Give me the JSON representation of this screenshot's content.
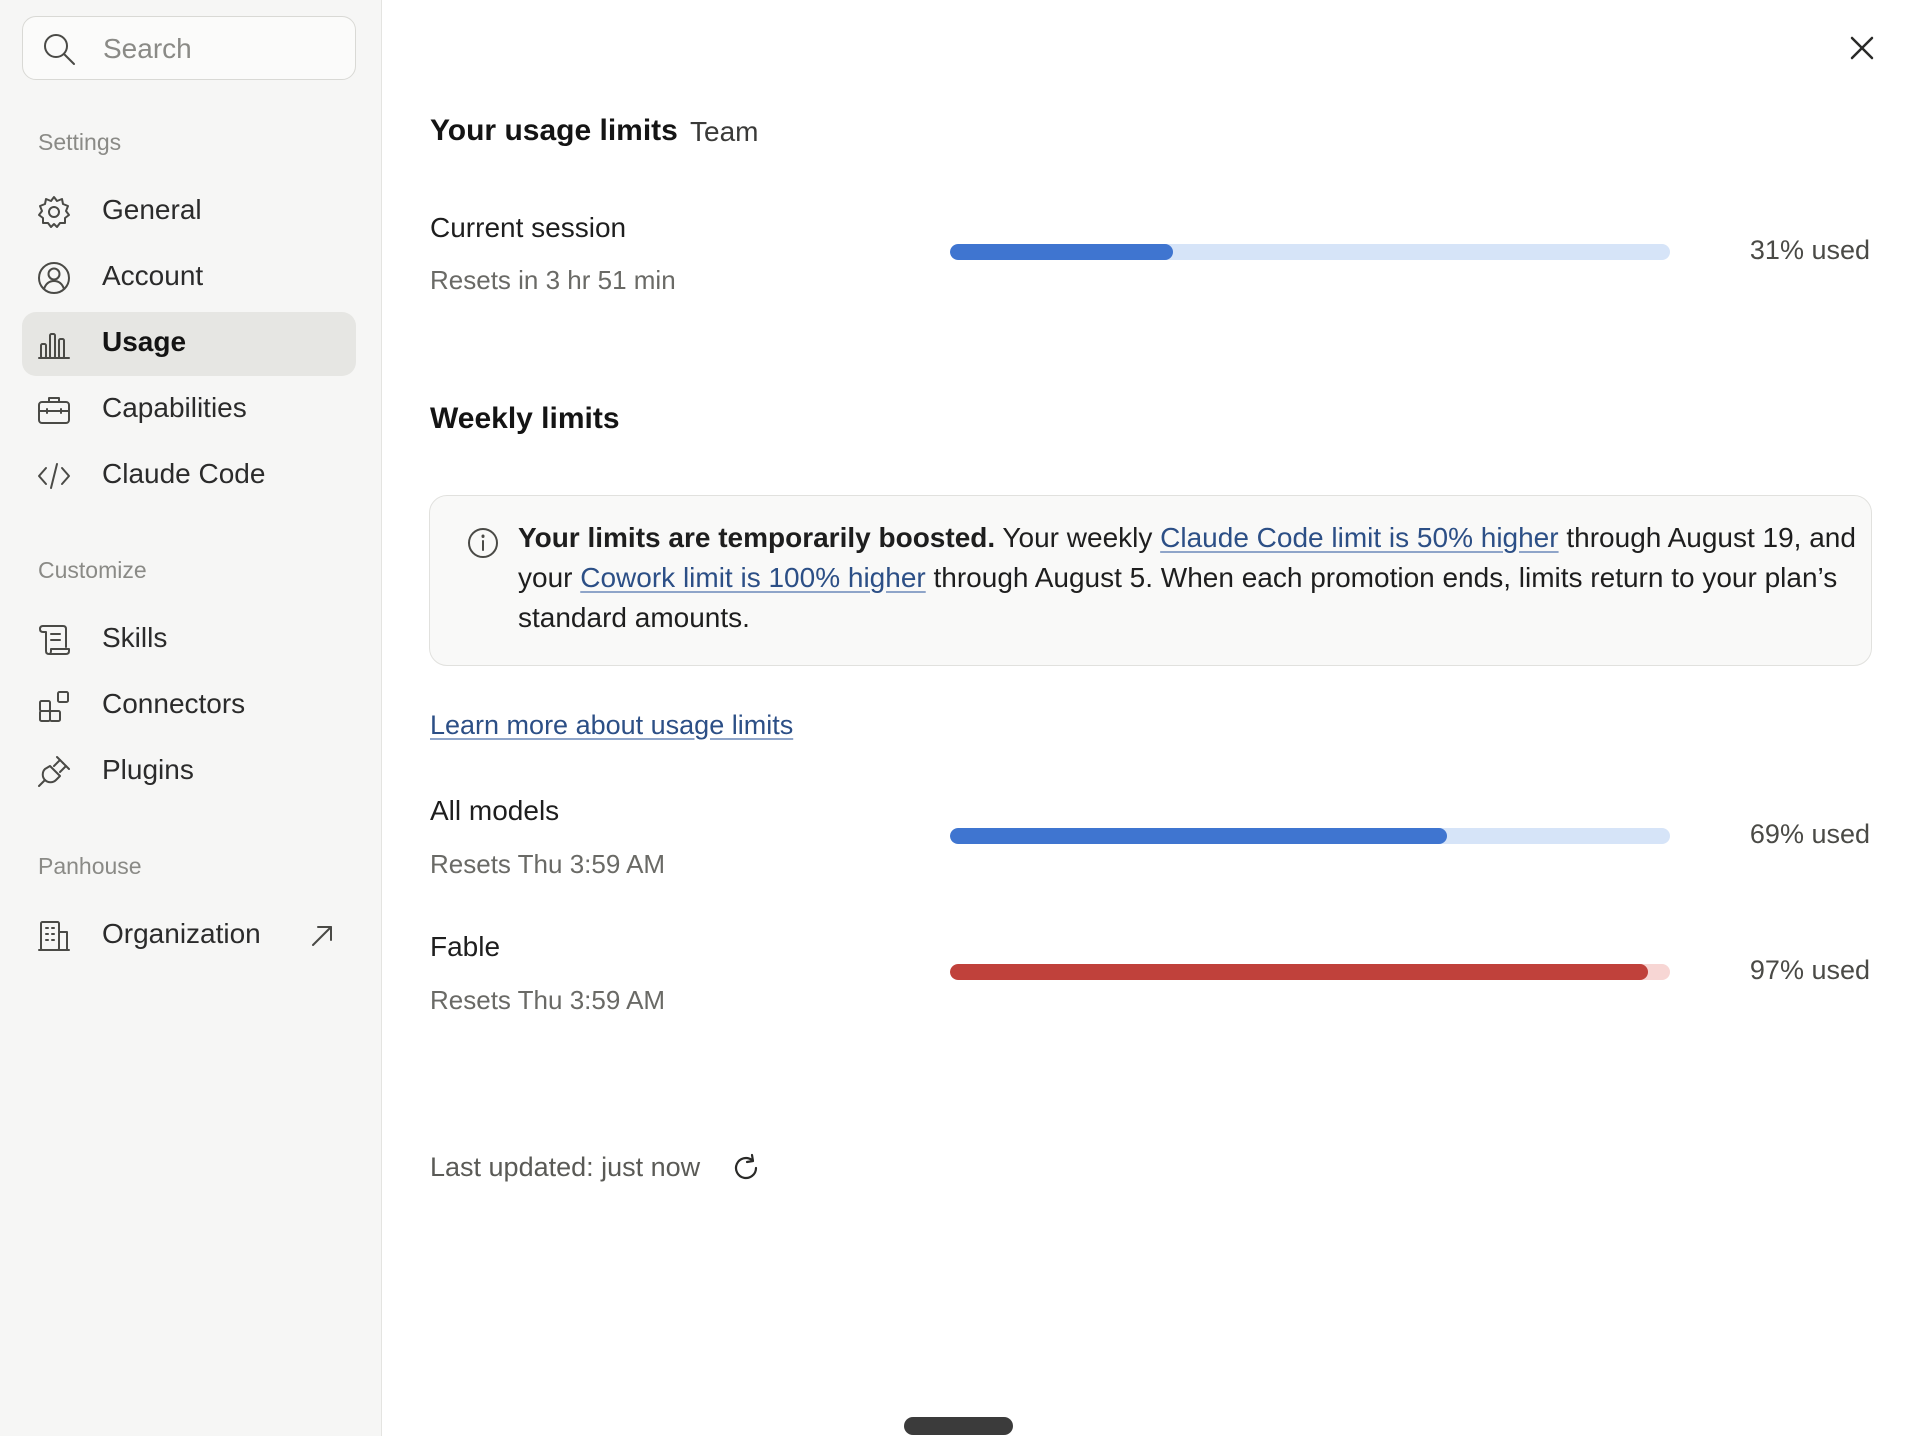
{
  "search": {
    "placeholder": "Search"
  },
  "sidebar": {
    "sections": [
      {
        "label": "Settings"
      },
      {
        "label": "Customize"
      },
      {
        "label": "Panhouse"
      }
    ],
    "items": [
      {
        "label": "General",
        "icon": "gear-icon"
      },
      {
        "label": "Account",
        "icon": "user-circle-icon"
      },
      {
        "label": "Usage",
        "icon": "bar-chart-icon",
        "active": true
      },
      {
        "label": "Capabilities",
        "icon": "briefcase-icon"
      },
      {
        "label": "Claude Code",
        "icon": "code-icon"
      },
      {
        "label": "Skills",
        "icon": "scroll-icon"
      },
      {
        "label": "Connectors",
        "icon": "blocks-icon"
      },
      {
        "label": "Plugins",
        "icon": "plug-icon"
      },
      {
        "label": "Organization",
        "icon": "building-icon",
        "external": true
      }
    ]
  },
  "main": {
    "title": "Your usage limits",
    "plan": "Team",
    "current_session": {
      "title": "Current session",
      "subtitle": "Resets in 3 hr 51 min",
      "used_fraction": 0.31,
      "pct_label": "31% used",
      "color": "#3f75d0"
    },
    "weekly_title": "Weekly limits",
    "notice": {
      "bold": "Your limits are temporarily boosted.",
      "t1": " Your weekly ",
      "link1": "Claude Code limit is 50% higher",
      "t2": " through August 19, and your ",
      "link2": "Cowork limit is 100% higher",
      "t3": " through August 5. When each promotion ends, limits return to your plan’s standard amounts."
    },
    "learn_more": "Learn more about usage limits",
    "limits": [
      {
        "title": "All models",
        "subtitle": "Resets Thu 3:59 AM",
        "used_fraction": 0.69,
        "pct_label": "69% used",
        "color": "#3f75d0"
      },
      {
        "title": "Fable",
        "subtitle": "Resets Thu 3:59 AM",
        "used_fraction": 0.97,
        "pct_label": "97% used",
        "color": "#c0413b"
      }
    ],
    "last_updated": "Last updated: just now"
  }
}
